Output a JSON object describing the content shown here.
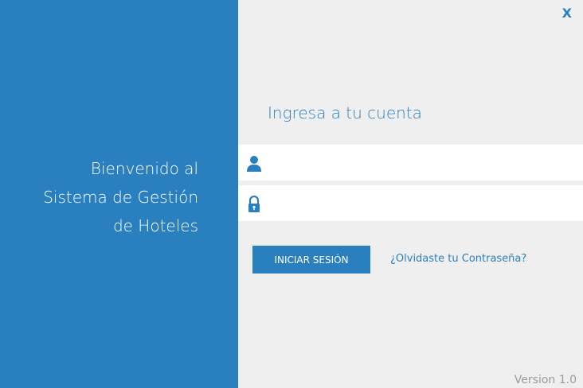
{
  "window": {
    "close_label": "X"
  },
  "welcome": {
    "line1": "Bienvenido al",
    "line2": "Sistema de Gestión",
    "line3": "de Hoteles"
  },
  "login": {
    "title": "Ingresa a tu cuenta",
    "username": {
      "value": "",
      "placeholder": "",
      "icon": "user-icon"
    },
    "password": {
      "value": "",
      "placeholder": "",
      "icon": "lock-icon"
    },
    "submit_label": "INICIAR SESIÓN",
    "forgot_label": "¿Olvidaste tu Contraseña?"
  },
  "footer": {
    "version": "Version 1.0"
  },
  "colors": {
    "accent": "#2a7fbe",
    "background": "#efefef",
    "field": "#ffffff",
    "muted": "#9a9a9a"
  }
}
